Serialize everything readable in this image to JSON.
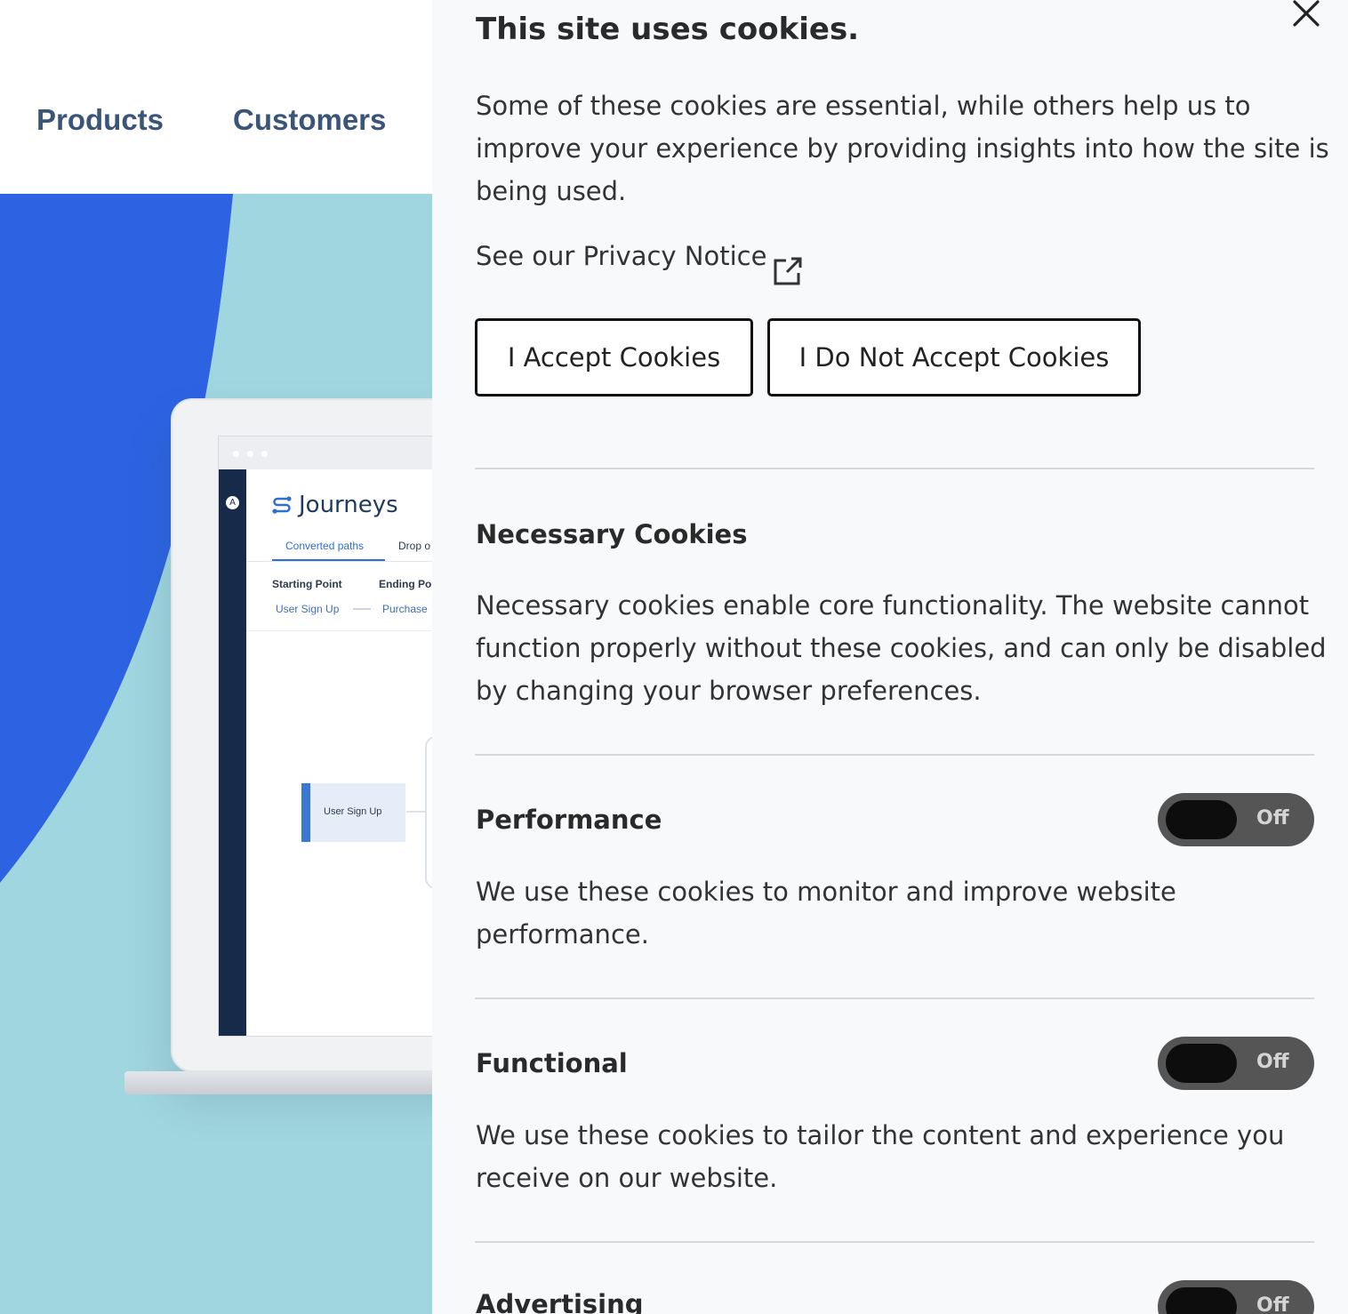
{
  "nav": {
    "products": "Products",
    "customers": "Customers"
  },
  "app_preview": {
    "title": "Journeys",
    "tabs": [
      "Converted paths",
      "Drop o"
    ],
    "starting_label": "Starting Point",
    "starting_value": "User Sign Up",
    "ending_label": "Ending Poi",
    "ending_value": "Purchase",
    "node_label": "User Sign Up"
  },
  "cookie_panel": {
    "title": "This site uses cookies.",
    "description": "Some of these cookies are essential, while others help us to improve your experience by providing insights into how the site is being used.",
    "privacy_link": "See our Privacy Notice",
    "accept_label": "I Accept Cookies",
    "decline_label": "I Do Not Accept Cookies",
    "sections": [
      {
        "title": "Necessary Cookies",
        "description": "Necessary cookies enable core functionality. The website cannot function properly without these cookies, and can only be disabled by changing your browser preferences."
      },
      {
        "title": "Performance",
        "description": "We use these cookies to monitor and improve website performance.",
        "toggle": "Off"
      },
      {
        "title": "Functional",
        "description": "We use these cookies to tailor the content and experience you receive on our website.",
        "toggle": "Off"
      },
      {
        "title": "Advertising",
        "toggle": "Off"
      }
    ]
  },
  "colors": {
    "nav_text": "#3b5578",
    "hero_blue": "#2d63e2",
    "hero_teal": "#a0d6e0",
    "panel_bg": "#f8f9fb",
    "toggle_track": "#555555"
  }
}
